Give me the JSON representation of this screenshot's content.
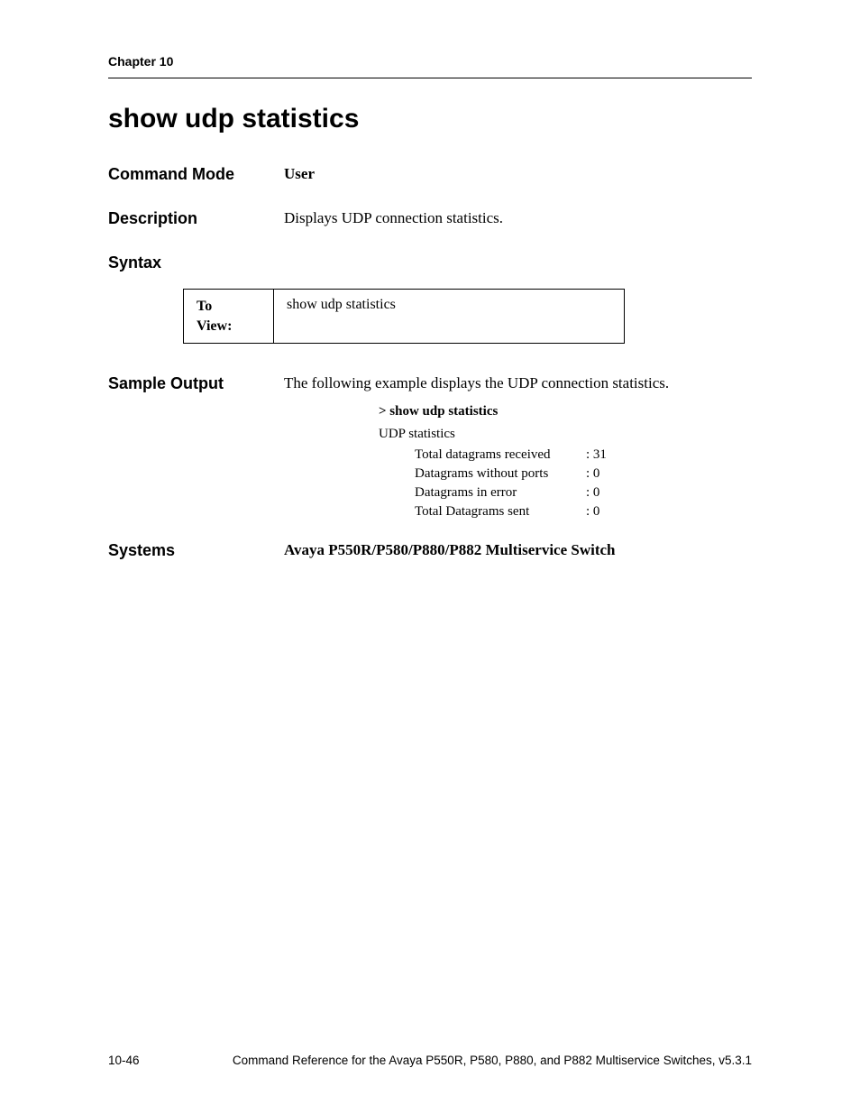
{
  "chapter": "Chapter 10",
  "title": "show udp statistics",
  "sections": {
    "command_mode": {
      "label": "Command Mode",
      "value": "User"
    },
    "description": {
      "label": "Description",
      "value": "Displays UDP connection statistics."
    },
    "syntax": {
      "label": "Syntax",
      "table_left_line1": "To",
      "table_left_line2": "View:",
      "table_right": "show udp statistics"
    },
    "sample_output": {
      "label": "Sample Output",
      "intro": "The following example displays the UDP connection statistics.",
      "command": "> show udp statistics",
      "header_line": "UDP statistics",
      "stats": [
        {
          "label": "Total datagrams received",
          "value": ": 31"
        },
        {
          "label": "Datagrams without ports",
          "value": ": 0"
        },
        {
          "label": "Datagrams in error",
          "value": ": 0"
        },
        {
          "label": "Total Datagrams sent",
          "value": ": 0"
        }
      ]
    },
    "systems": {
      "label": "Systems",
      "value": "Avaya P550R/P580/P880/P882 Multiservice Switch"
    }
  },
  "footer": {
    "page": "10-46",
    "doc": "Command Reference for the Avaya P550R, P580, P880, and P882 Multiservice Switches, v5.3.1"
  }
}
